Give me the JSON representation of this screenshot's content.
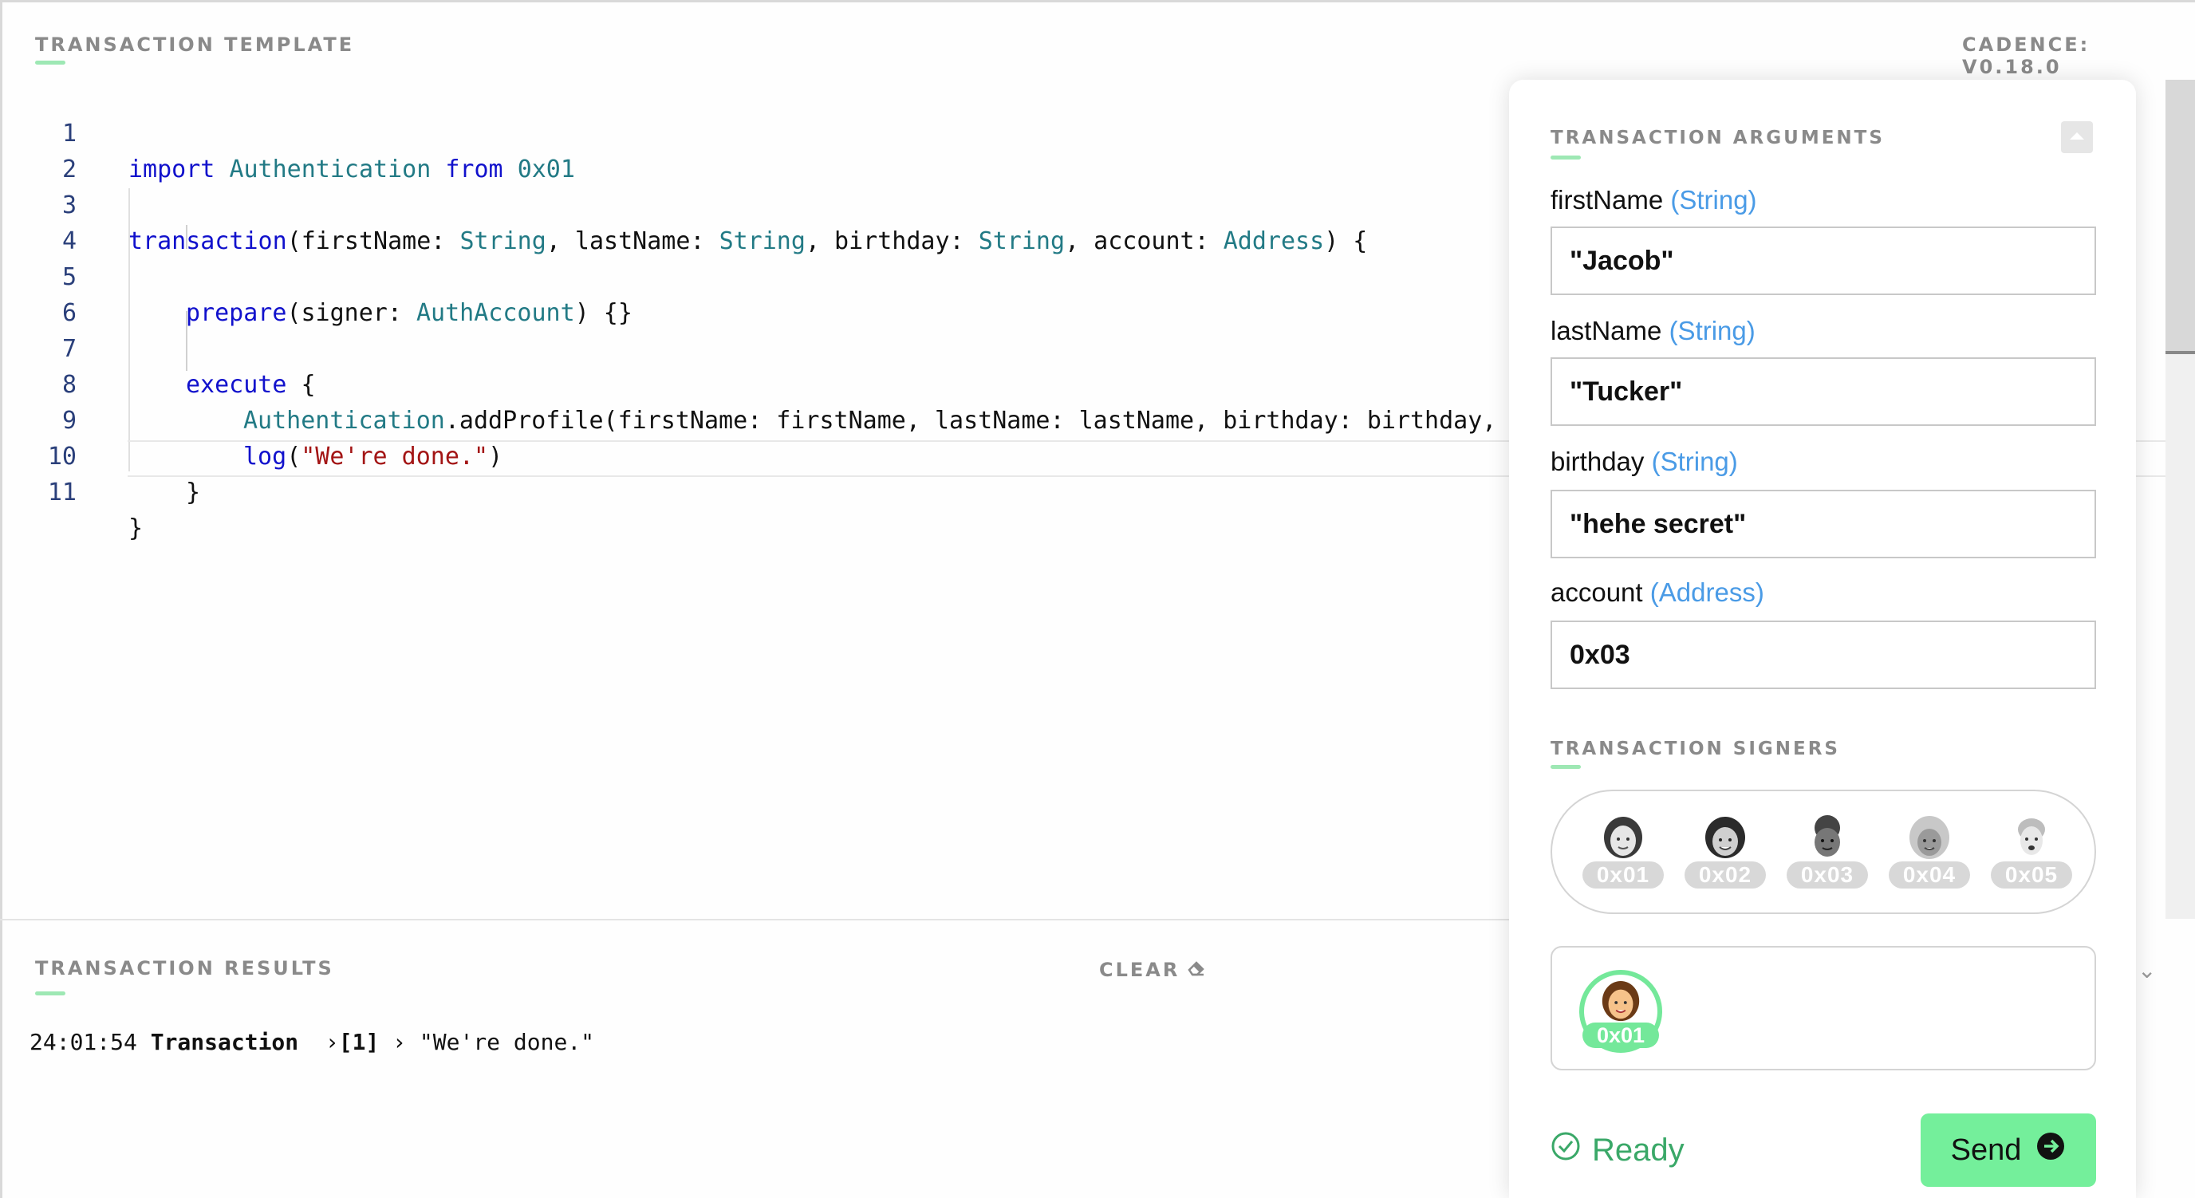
{
  "editor": {
    "title": "TRANSACTION TEMPLATE",
    "version": "CADENCE: V0.18.0",
    "line_numbers": [
      "1",
      "2",
      "3",
      "4",
      "5",
      "6",
      "7",
      "8",
      "9",
      "10",
      "11"
    ],
    "tokens": {
      "l1_import": "import",
      "l1_module": "Authentication",
      "l1_from": "from",
      "l1_addr": "0x01",
      "l3_kw": "transaction",
      "l3_p1": "(firstName: ",
      "l3_t1": "String",
      "l3_p2": ", lastName: ",
      "l3_t2": "String",
      "l3_p3": ", birthday: ",
      "l3_t3": "String",
      "l3_p4": ", account: ",
      "l3_t4": "Address",
      "l3_p5": ") {",
      "l5_kw": "prepare",
      "l5_p1": "(signer: ",
      "l5_t1": "AuthAccount",
      "l5_p2": ") {}",
      "l7_kw": "execute",
      "l7_p1": " {",
      "l8_ty": "Authentication",
      "l8_p1": ".addProfile(firstName: firstName, lastName: lastName, birthday: birthday,",
      "l9_kw": "log",
      "l9_p1": "(",
      "l9_str": "\"We're done.\"",
      "l9_p2": ")",
      "l10": "}",
      "l11": "}"
    }
  },
  "results": {
    "title": "TRANSACTION RESULTS",
    "clear_label": "CLEAR",
    "time": "24:01:54",
    "kind": "Transaction",
    "index": "[1]",
    "message": "\"We're done.\""
  },
  "panel": {
    "args_title": "TRANSACTION ARGUMENTS",
    "arguments": [
      {
        "name": "firstName",
        "type": "(String)",
        "value": "\"Jacob\""
      },
      {
        "name": "lastName",
        "type": "(String)",
        "value": "\"Tucker\""
      },
      {
        "name": "birthday",
        "type": "(String)",
        "value": "\"hehe secret\""
      },
      {
        "name": "account",
        "type": "(Address)",
        "value": "0x03"
      }
    ],
    "signers_title": "TRANSACTION SIGNERS",
    "signers": [
      "0x01",
      "0x02",
      "0x03",
      "0x04",
      "0x05"
    ],
    "selected_signer": "0x01",
    "status": "Ready",
    "send_label": "Send"
  },
  "colors": {
    "accent_green": "#74ef9b",
    "type_blue": "#4a9be6",
    "keyword": "#1111cc",
    "type_teal": "#227a85",
    "string": "#a31515",
    "ready_green": "#3aa868"
  }
}
